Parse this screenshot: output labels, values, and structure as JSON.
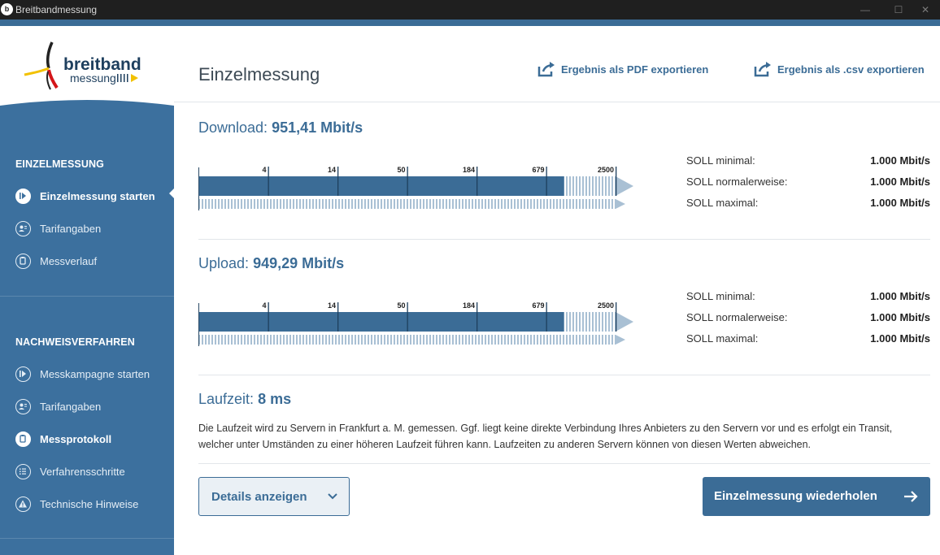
{
  "window": {
    "title": "Breitbandmessung",
    "app_icon": "breitband-app-icon"
  },
  "logo": {
    "word1": "breitband",
    "word2": "messung"
  },
  "sidebar": {
    "section1": {
      "heading": "EINZELMESSUNG",
      "items": [
        {
          "label": "Einzelmessung starten",
          "icon": "play-circle-icon",
          "active": true
        },
        {
          "label": "Tarifangaben",
          "icon": "user-card-icon"
        },
        {
          "label": "Messverlauf",
          "icon": "clipboard-icon"
        }
      ]
    },
    "section2": {
      "heading": "NACHWEISVERFAHREN",
      "items": [
        {
          "label": "Messkampagne starten",
          "icon": "play-circle-icon"
        },
        {
          "label": "Tarifangaben",
          "icon": "user-card-icon"
        },
        {
          "label": "Messprotokoll",
          "icon": "clipboard-icon"
        },
        {
          "label": "Verfahrensschritte",
          "icon": "list-icon"
        },
        {
          "label": "Technische Hinweise",
          "icon": "warning-icon"
        }
      ]
    }
  },
  "main": {
    "title": "Einzelmessung",
    "export_pdf": "Ergebnis als PDF exportieren",
    "export_csv": "Ergebnis als .csv exportieren",
    "download": {
      "label": "Download:",
      "value": "951,41 Mbit/s",
      "measured_mbit": 951.41,
      "scale_ticks": [
        "4",
        "14",
        "50",
        "184",
        "679",
        "2500"
      ],
      "soll": [
        {
          "label": "SOLL minimal:",
          "value": "1.000 Mbit/s"
        },
        {
          "label": "SOLL normalerweise:",
          "value": "1.000 Mbit/s"
        },
        {
          "label": "SOLL maximal:",
          "value": "1.000 Mbit/s"
        }
      ]
    },
    "upload": {
      "label": "Upload:",
      "value": "949,29 Mbit/s",
      "measured_mbit": 949.29,
      "scale_ticks": [
        "4",
        "14",
        "50",
        "184",
        "679",
        "2500"
      ],
      "soll": [
        {
          "label": "SOLL minimal:",
          "value": "1.000 Mbit/s"
        },
        {
          "label": "SOLL normalerweise:",
          "value": "1.000 Mbit/s"
        },
        {
          "label": "SOLL maximal:",
          "value": "1.000 Mbit/s"
        }
      ]
    },
    "latency": {
      "label": "Laufzeit:",
      "value": "8 ms",
      "text": "Die Laufzeit wird zu Servern in Frankfurt a. M. gemessen. Ggf. liegt keine direkte Verbindung Ihres Anbieters zu den Servern vor und es erfolgt ein Transit, welcher unter Umständen zu einer höheren Laufzeit führen kann. Laufzeiten zu anderen Servern können von diesen Werten abweichen."
    },
    "details_button": "Details anzeigen",
    "repeat_button": "Einzelmessung wiederholen"
  },
  "colors": {
    "primary": "#3b6c96",
    "sidebar": "#3c709e",
    "bar_light": "#a9c0d4"
  }
}
